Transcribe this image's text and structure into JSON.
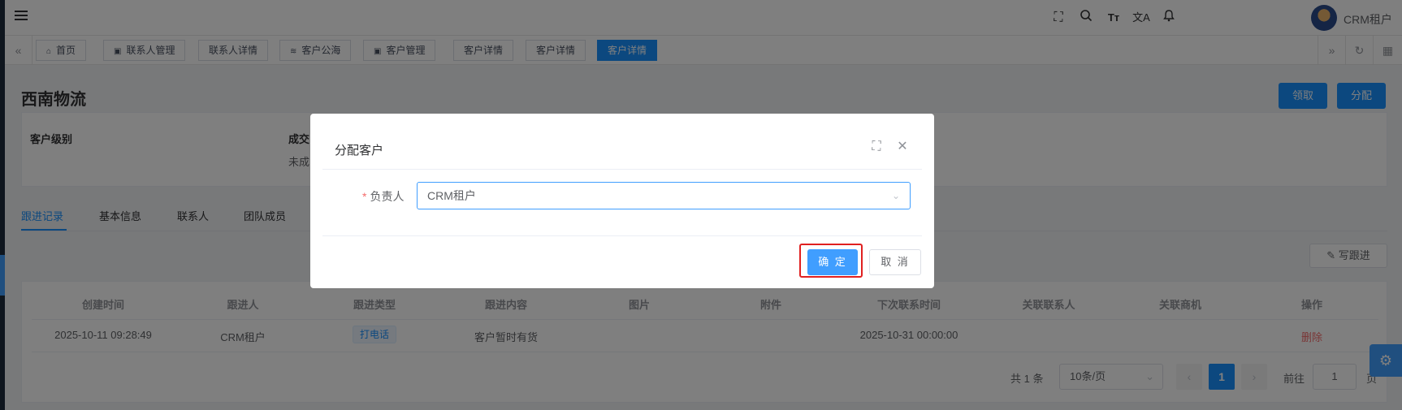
{
  "navbar": {
    "user_name": "CRM租户",
    "icons": [
      "fullscreen-icon",
      "search-icon",
      "font-size-icon",
      "translate-icon",
      "bell-icon"
    ]
  },
  "tags": [
    {
      "label": "首页",
      "icon": "home-icon"
    },
    {
      "label": "联系人管理",
      "icon": "doc-icon"
    },
    {
      "label": "联系人详情"
    },
    {
      "label": "客户公海",
      "icon": "sea-icon"
    },
    {
      "label": "客户管理",
      "icon": "doc-icon"
    },
    {
      "label": "客户详情"
    },
    {
      "label": "客户详情"
    },
    {
      "label": "客户详情",
      "active": true
    }
  ],
  "page": {
    "title": "西南物流",
    "claim_button": "领取",
    "assign_button": "分配",
    "info": {
      "level_label": "客户级别",
      "deal_label": "成交",
      "deal_value": "未成"
    },
    "tabs": [
      "跟进记录",
      "基本信息",
      "联系人",
      "团队成员"
    ],
    "write_followup_button": "写跟进"
  },
  "table": {
    "headers": [
      "创建时间",
      "跟进人",
      "跟进类型",
      "跟进内容",
      "图片",
      "附件",
      "下次联系时间",
      "关联联系人",
      "关联商机",
      "操作"
    ],
    "rows": [
      {
        "created": "2025-10-11 09:28:49",
        "owner": "CRM租户",
        "type": "打电话",
        "content": "客户暂时有货",
        "image": "",
        "attachment": "",
        "next_contact": "2025-10-31 00:00:00",
        "contact": "",
        "opportunity": "",
        "action": "删除"
      }
    ]
  },
  "pagination": {
    "total": "共 1 条",
    "page_size": "10条/页",
    "current": "1",
    "goto_label": "前往",
    "goto_value": "1",
    "page_suffix": "页"
  },
  "dialog": {
    "title": "分配客户",
    "owner_label": "负责人",
    "required_mark": "*",
    "owner_value": "CRM租户",
    "confirm_button": "确 定",
    "cancel_button": "取 消"
  },
  "colors": {
    "primary": "#1890ff",
    "dialog_primary": "#409eff",
    "danger": "#f56c6c",
    "highlight": "#e02020"
  }
}
